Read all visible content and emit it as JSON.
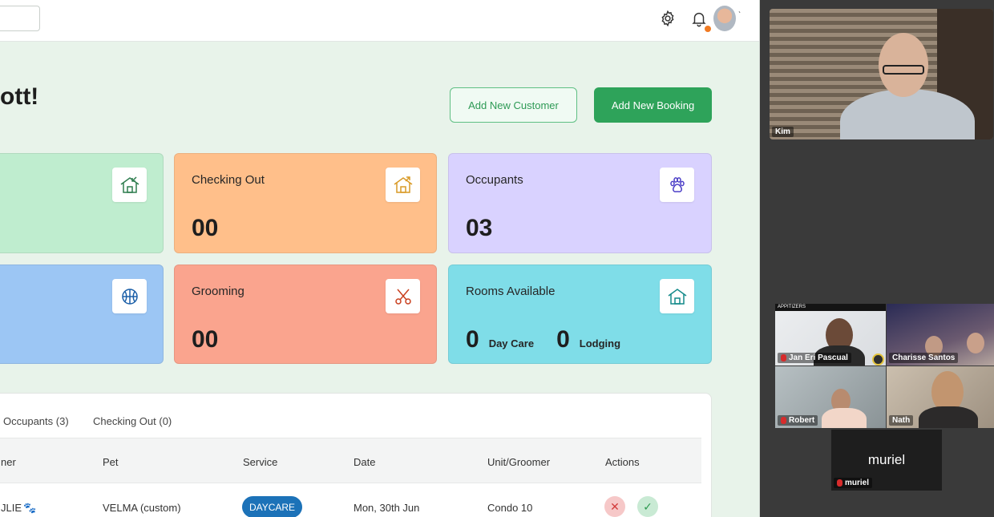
{
  "header": {
    "icons": [
      "gear-icon",
      "bell-icon",
      "avatar"
    ],
    "notification_color": "#f07a22"
  },
  "page": {
    "greeting": "ott!",
    "add_customer_label": "Add New Customer",
    "add_booking_label": "Add New Booking"
  },
  "cards": {
    "checking_out": {
      "title": "Checking Out",
      "value": "00",
      "icon": "house-out-icon"
    },
    "occupants": {
      "title": "Occupants",
      "value": "03",
      "icon": "paw-icon"
    },
    "grooming": {
      "title": "Grooming",
      "value": "00",
      "icon": "scissors-icon"
    },
    "rooms": {
      "title": "Rooms Available",
      "daycare_value": "0",
      "daycare_label": "Day Care",
      "lodging_value": "0",
      "lodging_label": "Lodging",
      "icon": "home-icon"
    }
  },
  "colors": {
    "green": "#bfedcf",
    "orange": "#ffbf8a",
    "purple": "#d9d2ff",
    "blue": "#9cc6f4",
    "salmon": "#faa48e",
    "cyan": "#7fdde8",
    "primary": "#2ea35a",
    "service_pill": "#1c72b8"
  },
  "table": {
    "tabs": [
      "Occupants (3)",
      "Checking Out (0)"
    ],
    "headers": [
      "ner",
      "Pet",
      "Service",
      "Date",
      "Unit/Groomer",
      "Actions"
    ],
    "row": {
      "owner": "JLIE",
      "pet": "VELMA (custom)",
      "service": "DAYCARE",
      "date": "Mon, 30th Jun",
      "unit": "Condo 10"
    }
  },
  "call": {
    "participants": [
      "Kim",
      "Jan Eri Pascual",
      "Charisse Santos",
      "Robert",
      "Nath",
      "muriel"
    ],
    "center_name": "muriel",
    "banner_text": "APPITIZERS"
  }
}
